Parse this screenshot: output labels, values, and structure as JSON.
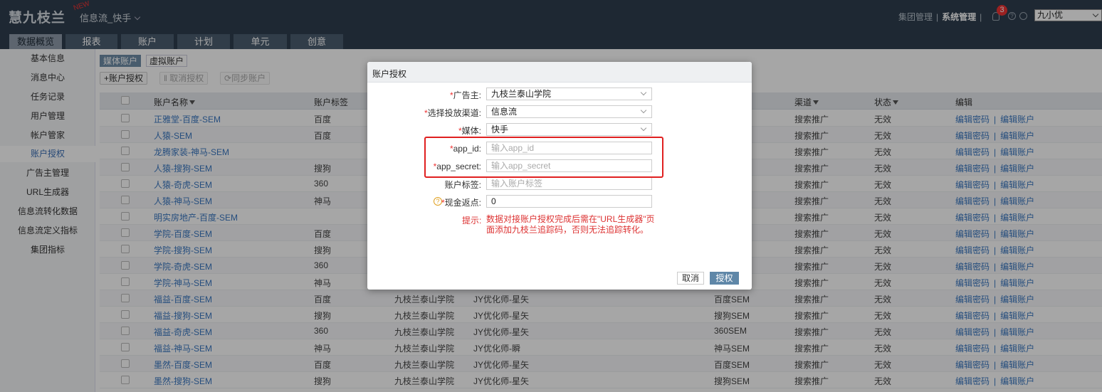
{
  "header": {
    "logo": "慧九枝兰",
    "new_badge": "NEW",
    "product": "信息流_快手",
    "links": [
      "集团管理",
      "系统管理"
    ],
    "notif_count": "3",
    "user": "九小优"
  },
  "nav": {
    "tabs": [
      "数据概览",
      "报表",
      "账户",
      "计划",
      "单元",
      "创意"
    ]
  },
  "sidebar": {
    "items": [
      "基本信息",
      "消息中心",
      "任务记录",
      "用户管理",
      "帐户管家",
      "账户授权",
      "广告主管理",
      "URL生成器",
      "信息流转化数据",
      "信息流定义指标",
      "集团指标"
    ]
  },
  "subtabs": [
    "媒体账户",
    "虚拟账户"
  ],
  "toolbar": {
    "add": "+账户授权",
    "cancel": "取消授权",
    "sync": "同步账户"
  },
  "table": {
    "headers": {
      "name": "账户名称",
      "tag": "账户标签",
      "channel": "渠道",
      "status": "状态",
      "edit": "编辑"
    },
    "action_pwd": "编辑密码",
    "action_sep": "|",
    "action_acct": "编辑账户",
    "rows": [
      {
        "name": "正雅堂-百度-SEM",
        "tag": "百度",
        "advertiser": "",
        "owner": "",
        "media": "",
        "channel": "搜索推广",
        "status": "无效"
      },
      {
        "name": "人猿-SEM",
        "tag": "百度",
        "advertiser": "",
        "owner": "",
        "media": "",
        "channel": "搜索推广",
        "status": "无效"
      },
      {
        "name": "龙腾家装-神马-SEM",
        "tag": "",
        "advertiser": "",
        "owner": "",
        "media": "",
        "channel": "搜索推广",
        "status": "无效"
      },
      {
        "name": "人猿-搜狗-SEM",
        "tag": "搜狗",
        "advertiser": "",
        "owner": "",
        "media": "",
        "channel": "搜索推广",
        "status": "无效"
      },
      {
        "name": "人猿-奇虎-SEM",
        "tag": "360",
        "advertiser": "",
        "owner": "",
        "media": "",
        "channel": "搜索推广",
        "status": "无效"
      },
      {
        "name": "人猿-神马-SEM",
        "tag": "神马",
        "advertiser": "",
        "owner": "",
        "media": "",
        "channel": "搜索推广",
        "status": "无效"
      },
      {
        "name": "明实房地产-百度-SEM",
        "tag": "",
        "advertiser": "",
        "owner": "",
        "media": "",
        "channel": "搜索推广",
        "status": "无效"
      },
      {
        "name": "学院-百度-SEM",
        "tag": "百度",
        "advertiser": "",
        "owner": "",
        "media": "",
        "channel": "搜索推广",
        "status": "无效"
      },
      {
        "name": "学院-搜狗-SEM",
        "tag": "搜狗",
        "advertiser": "",
        "owner": "",
        "media": "",
        "channel": "搜索推广",
        "status": "无效"
      },
      {
        "name": "学院-奇虎-SEM",
        "tag": "360",
        "advertiser": "",
        "owner": "",
        "media": "",
        "channel": "搜索推广",
        "status": "无效"
      },
      {
        "name": "学院-神马-SEM",
        "tag": "神马",
        "advertiser": "",
        "owner": "",
        "media": "",
        "channel": "搜索推广",
        "status": "无效"
      },
      {
        "name": "福益-百度-SEM",
        "tag": "百度",
        "advertiser": "九枝兰泰山学院",
        "owner": "JY优化师-星矢",
        "media": "百度SEM",
        "channel": "搜索推广",
        "status": "无效"
      },
      {
        "name": "福益-搜狗-SEM",
        "tag": "搜狗",
        "advertiser": "九枝兰泰山学院",
        "owner": "JY优化师-星矢",
        "media": "搜狗SEM",
        "channel": "搜索推广",
        "status": "无效"
      },
      {
        "name": "福益-奇虎-SEM",
        "tag": "360",
        "advertiser": "九枝兰泰山学院",
        "owner": "JY优化师-星矢",
        "media": "360SEM",
        "channel": "搜索推广",
        "status": "无效"
      },
      {
        "name": "福益-神马-SEM",
        "tag": "神马",
        "advertiser": "九枝兰泰山学院",
        "owner": "JY优化师-瞬",
        "media": "神马SEM",
        "channel": "搜索推广",
        "status": "无效"
      },
      {
        "name": "墨然-百度-SEM",
        "tag": "百度",
        "advertiser": "九枝兰泰山学院",
        "owner": "JY优化师-星矢",
        "media": "百度SEM",
        "channel": "搜索推广",
        "status": "无效"
      },
      {
        "name": "墨然-搜狗-SEM",
        "tag": "搜狗",
        "advertiser": "九枝兰泰山学院",
        "owner": "JY优化师-星矢",
        "media": "搜狗SEM",
        "channel": "搜索推广",
        "status": "无效"
      }
    ]
  },
  "dialog": {
    "title": "账户授权",
    "fields": {
      "advertiser_label": "广告主:",
      "advertiser_value": "九枝兰泰山学院",
      "channel_label": "选择投放渠道:",
      "channel_value": "信息流",
      "media_label": "媒体:",
      "media_value": "快手",
      "appid_label": "app_id:",
      "appid_placeholder": "输入app_id",
      "secret_label": "app_secret:",
      "secret_placeholder": "输入app_secret",
      "tag_label": "账户标签:",
      "tag_placeholder": "输入账户标签",
      "rebate_label": "现金返点:",
      "rebate_value": "0",
      "required_mark": "*",
      "hint_icon": "?"
    },
    "tip_label": "提示:",
    "tip_text": "数据对接账户授权完成后需在\"URL生成器\"页面添加九枝兰追踪码，否则无法追踪转化。",
    "cancel_label": "取消",
    "ok_label": "授权"
  }
}
